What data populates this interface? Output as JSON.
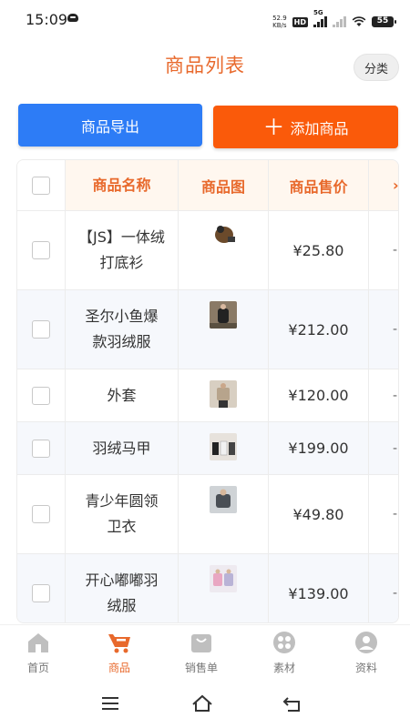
{
  "status_bar": {
    "time": "15:09",
    "net_speed_value": "52.9",
    "net_speed_unit": "KB/s",
    "hd": "HD",
    "sig_label": "5G",
    "battery": "55"
  },
  "header": {
    "title": "商品列表",
    "category_button": "分类"
  },
  "actions": {
    "export_label": "商品导出",
    "add_icon": "＋",
    "add_label": "添加商品"
  },
  "table": {
    "columns": [
      "商品名称",
      "商品图",
      "商品售价"
    ],
    "rows": [
      {
        "name": "【JS】一体绒打底衫",
        "price": "¥25.80"
      },
      {
        "name": "圣尔小鱼爆款羽绒服",
        "price": "¥212.00"
      },
      {
        "name": "外套",
        "price": "¥120.00"
      },
      {
        "name": "羽绒马甲",
        "price": "¥199.00"
      },
      {
        "name": "青少年圆领卫衣",
        "price": "¥49.80"
      },
      {
        "name": "开心嘟嘟羽绒服",
        "price": "¥139.00"
      }
    ]
  },
  "tabbar": {
    "items": [
      {
        "label": "首页",
        "icon": "home-icon"
      },
      {
        "label": "商品",
        "icon": "cart-icon"
      },
      {
        "label": "销售单",
        "icon": "bag-icon"
      },
      {
        "label": "素材",
        "icon": "grid-icon"
      },
      {
        "label": "资料",
        "icon": "profile-icon"
      }
    ],
    "active_color": "#e8692c"
  },
  "colors": {
    "accent": "#e8692c",
    "export_button": "#2d7cf6",
    "add_button": "#fa5a0a"
  }
}
